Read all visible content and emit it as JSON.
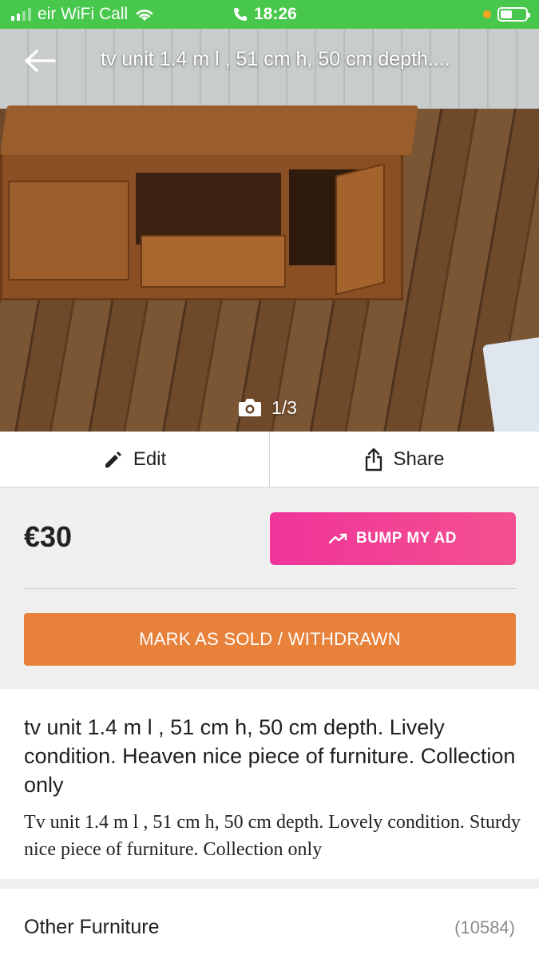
{
  "status_bar": {
    "carrier": "eir WiFi Call",
    "time": "18:26"
  },
  "photo": {
    "title": "tv unit 1.4 m l , 51 cm h, 50 cm depth....",
    "counter": "1/3"
  },
  "actions": {
    "edit_label": "Edit",
    "share_label": "Share"
  },
  "listing": {
    "price": "€30",
    "bump_label": "BUMP MY AD",
    "sold_label": "MARK AS SOLD / WITHDRAWN",
    "title": "tv unit 1.4 m l , 51 cm h, 50 cm depth. Lively condition. Heaven nice piece of furniture. Collection only",
    "description": "Tv unit  1.4 m l , 51 cm h, 50 cm depth. Lovely condition. Sturdy nice piece of furniture. Collection only"
  },
  "category": {
    "name": "Other Furniture",
    "count": "(10584)"
  },
  "colors": {
    "status_bar": "#47c74b",
    "bump_button": "#f0349a",
    "sold_button": "#e8813a"
  }
}
